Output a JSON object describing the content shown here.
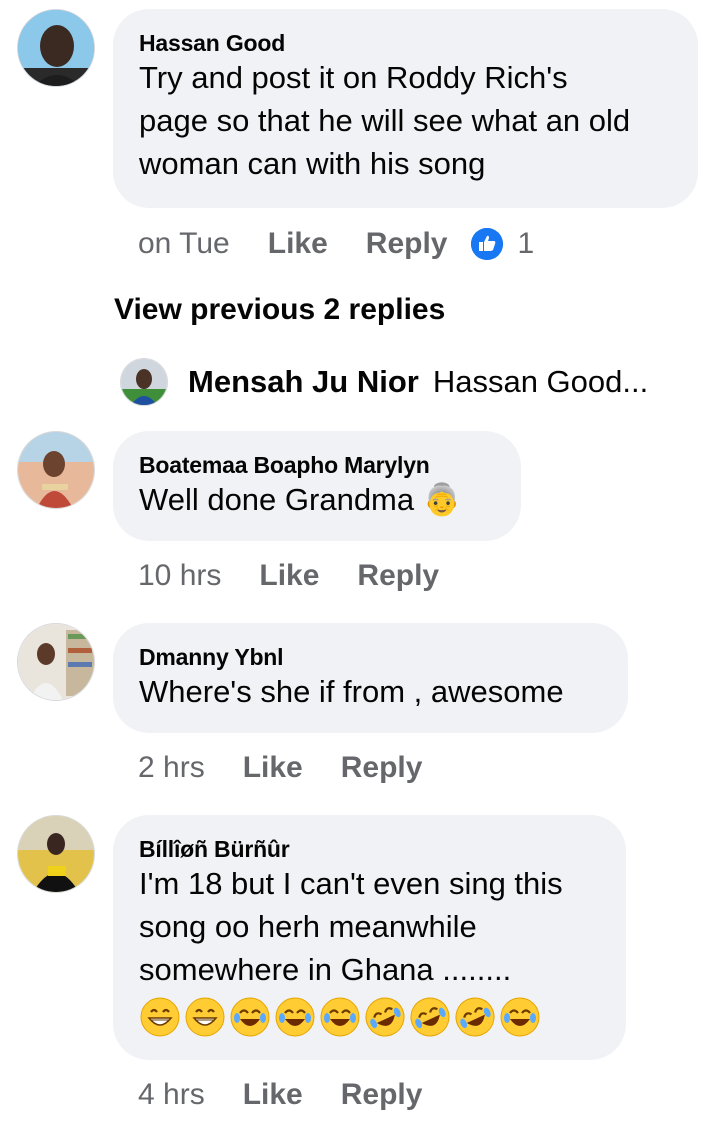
{
  "comments": [
    {
      "author": "Hassan Good",
      "lines": [
        "Try and post it on Roddy Rich's",
        "page so that he will see what an old",
        "woman can with his song"
      ],
      "time": "on Tue",
      "like_label": "Like",
      "reply_label": "Reply",
      "reaction_count": "1"
    },
    {
      "author": "Boatemaa Boapho Marylyn",
      "lines": [
        "Well done Grandma"
      ],
      "emoji": "👵",
      "time": "10 hrs",
      "like_label": "Like",
      "reply_label": "Reply"
    },
    {
      "author": "Dmanny Ybnl",
      "lines": [
        "Where's she if from , awesome"
      ],
      "time": "2 hrs",
      "like_label": "Like",
      "reply_label": "Reply"
    },
    {
      "author": "Bíllîøñ Bürñûr",
      "lines": [
        "I'm 18 but I can't even sing this",
        "song oo herh meanwhile",
        "somewhere in Ghana ........"
      ],
      "emojis": [
        "😁",
        "😁",
        "😂",
        "😂",
        "😂",
        "🤣",
        "🤣",
        "🤣",
        "😂"
      ],
      "time": "4 hrs",
      "like_label": "Like",
      "reply_label": "Reply"
    }
  ],
  "view_previous": "View previous 2 replies",
  "reply_preview": {
    "author": "Mensah Ju Nior",
    "text": "Hassan Good..."
  },
  "colors": {
    "bubble": "#f0f2f5",
    "secondary_text": "#65676b",
    "like_blue": "#1877f2"
  }
}
